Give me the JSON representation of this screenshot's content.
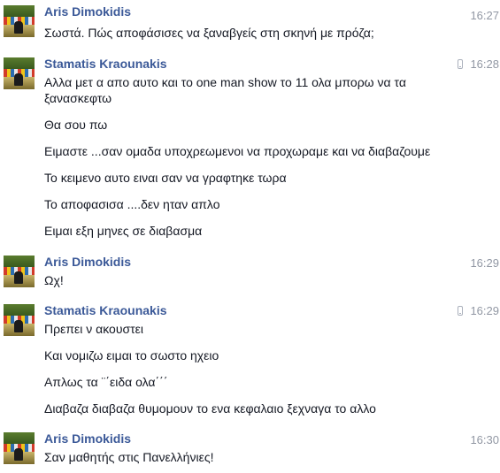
{
  "messages": [
    {
      "sender": "Aris Dimokidis",
      "time": "16:27",
      "mobile": false,
      "lines": [
        "Σωστά. Πώς αποφάσισες να ξαναβγείς στη σκηνή με πρόζα;"
      ]
    },
    {
      "sender": "Stamatis Kraounakis",
      "time": "16:28",
      "mobile": true,
      "lines": [
        "Αλλα μετ α απο αυτο και το one man show  το 11 ολα μπορω να τα ξανασκεφτω",
        "Θα σου πω",
        "Ειμαστε ...σαν ομαδα υποχρεωμενοι να προχωραμε και να διαβαζουμε",
        "Το κειμενο αυτο ειναι σαν να γραφτηκε τωρα",
        "Το αποφασισα ....δεν ηταν απλο",
        "Ειμαι εξη μηνες σε διαβασμα"
      ]
    },
    {
      "sender": "Aris Dimokidis",
      "time": "16:29",
      "mobile": false,
      "lines": [
        "Ωχ!"
      ]
    },
    {
      "sender": "Stamatis Kraounakis",
      "time": "16:29",
      "mobile": true,
      "lines": [
        "Πρεπει ν ακουστει",
        "Και νομιζω ειμαι το σωστο ηχειο",
        "Απλως τα ¨΄ειδα ολα΄΄΄",
        "Διαβαζα διαβαζα θυμομουν το ενα κεφαλαιο ξεχναγα το αλλο"
      ]
    },
    {
      "sender": "Aris Dimokidis",
      "time": "16:30",
      "mobile": false,
      "lines": [
        "Σαν μαθητής στις Πανελλήνιες!"
      ]
    }
  ],
  "colors": {
    "sender": "#3b5998",
    "text": "#141823",
    "timestamp": "#9197a3"
  },
  "icons": {
    "mobile": "phone-icon",
    "avatar": "profile-photo"
  }
}
